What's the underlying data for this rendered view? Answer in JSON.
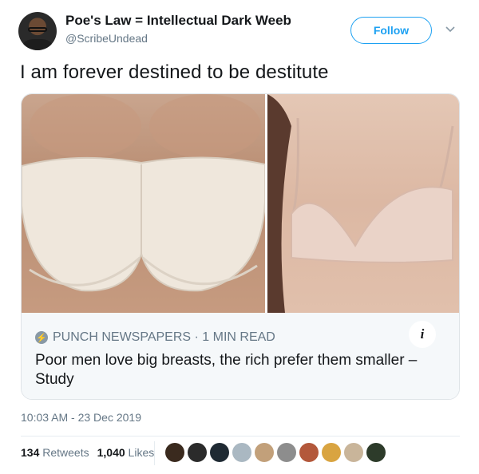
{
  "user": {
    "display_name": "Poe's Law = Intellectual Dark Weeb",
    "handle": "@ScribeUndead",
    "follow_label": "Follow"
  },
  "tweet": {
    "text": "I am forever destined to be destitute"
  },
  "card": {
    "source": "PUNCH NEWSPAPERS · 1 MIN READ",
    "headline": "Poor men love big breasts, the rich prefer them smaller –Study",
    "info_icon": "i"
  },
  "meta": {
    "timestamp": "10:03 AM - 23 Dec 2019",
    "retweets_count": "134",
    "retweets_label": "Retweets",
    "likes_count": "1,040",
    "likes_label": "Likes"
  },
  "colors": {
    "accent": "#1da1f2",
    "secondary_text": "#657786"
  },
  "likers": [
    {
      "icon": "liker-avatar-1",
      "color": "#3a2a1e"
    },
    {
      "icon": "liker-avatar-2",
      "color": "#2b2b2b"
    },
    {
      "icon": "liker-avatar-3",
      "color": "#1f2a33"
    },
    {
      "icon": "liker-avatar-4",
      "color": "#aab8c2"
    },
    {
      "icon": "liker-avatar-5",
      "color": "#c2a07a"
    },
    {
      "icon": "liker-avatar-6",
      "color": "#8d8d8d"
    },
    {
      "icon": "liker-avatar-7",
      "color": "#b3583b"
    },
    {
      "icon": "liker-avatar-8",
      "color": "#d9a441"
    },
    {
      "icon": "liker-avatar-9",
      "color": "#c9b59a"
    },
    {
      "icon": "liker-avatar-10",
      "color": "#2d3b2a"
    }
  ]
}
